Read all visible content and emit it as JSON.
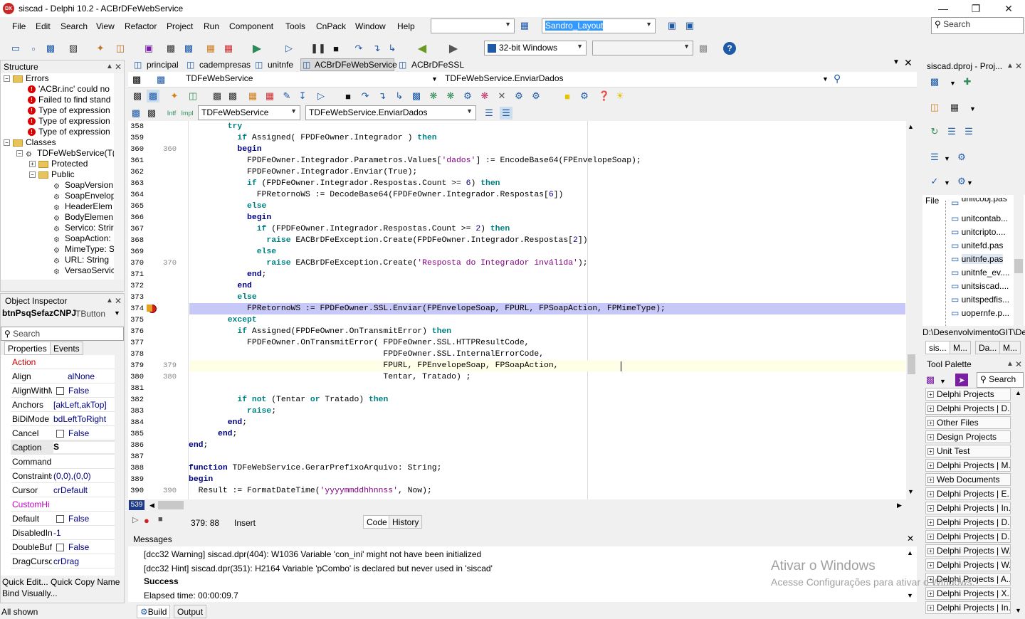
{
  "window": {
    "title": "siscad - Delphi 10.2 - ACBrDFeWebService",
    "app_icon": "DX"
  },
  "menu": [
    "File",
    "Edit",
    "Search",
    "View",
    "Refactor",
    "Project",
    "Run",
    "Component",
    "Tools",
    "CnPack",
    "Window",
    "Help"
  ],
  "toolbar": {
    "layout_combo": "Sandro_Layout",
    "platform_combo": "32-bit Windows",
    "search_placeholder": "Search"
  },
  "structure": {
    "title": "Structure",
    "items": [
      {
        "label": "Errors"
      },
      {
        "label": "'ACBr.inc' could no"
      },
      {
        "label": "Failed to find stand"
      },
      {
        "label": "Type of expression"
      },
      {
        "label": "Type of expression"
      },
      {
        "label": "Type of expression"
      },
      {
        "label": "Classes"
      },
      {
        "label": "TDFeWebService(T("
      },
      {
        "label": "Protected"
      },
      {
        "label": "Public"
      },
      {
        "label": "SoapVersion"
      },
      {
        "label": "SoapEnvelop"
      },
      {
        "label": "HeaderElem"
      },
      {
        "label": "BodyElemen"
      },
      {
        "label": "Servico: Strir"
      },
      {
        "label": "SoapAction:"
      },
      {
        "label": "MimeType: S"
      },
      {
        "label": "URL: String"
      },
      {
        "label": "VersaoServic"
      }
    ]
  },
  "object_inspector": {
    "title": "Object Inspector",
    "component": "btnPsqSefazCNPJ",
    "component_type": "TButton",
    "search_placeholder": "Search",
    "tabs": [
      "Properties",
      "Events"
    ],
    "rows": [
      {
        "name": "Action",
        "value": ""
      },
      {
        "name": "Align",
        "value": "alNone"
      },
      {
        "name": "AlignWithM",
        "value": "False"
      },
      {
        "name": "Anchors",
        "value": "[akLeft,akTop]"
      },
      {
        "name": "BiDiMode",
        "value": "bdLeftToRight"
      },
      {
        "name": "Cancel",
        "value": "False"
      },
      {
        "name": "Caption",
        "value": "S"
      },
      {
        "name": "Command",
        "value": ""
      },
      {
        "name": "Constraints",
        "value": "(0,0),(0,0)"
      },
      {
        "name": "Cursor",
        "value": "crDefault"
      },
      {
        "name": "CustomHi",
        "value": ""
      },
      {
        "name": "Default",
        "value": "False"
      },
      {
        "name": "DisabledIn",
        "value": "-1"
      },
      {
        "name": "DoubleBuf",
        "value": "False"
      },
      {
        "name": "DragCurso",
        "value": "crDrag"
      }
    ],
    "links": [
      "Quick Edit...",
      "Quick Copy Name",
      "Bind Visually..."
    ],
    "status": "All shown"
  },
  "editor_tabs": [
    "principal",
    "cadempresas",
    "unitnfe",
    "ACBrDFeWebService",
    "ACBrDFeSSL"
  ],
  "editor_header": {
    "class_combo": "TDFeWebService",
    "method_combo": "TDFeWebService.EnviarDados"
  },
  "editor_nav": {
    "class_combo": "TDFeWebService",
    "method_combo": "TDFeWebService.EnviarDados"
  },
  "code_lines": [
    {
      "n": "358",
      "m": "",
      "t": "        try"
    },
    {
      "n": "359",
      "m": "",
      "t": "          if Assigned( FPDFeOwner.Integrador ) then"
    },
    {
      "n": "360",
      "m": "360",
      "t": "          begin"
    },
    {
      "n": "361",
      "m": "",
      "t": "            FPDFeOwner.Integrador.Parametros.Values['dados'] := EncodeBase64(FPEnvelopeSoap);"
    },
    {
      "n": "362",
      "m": "",
      "t": "            FPDFeOwner.Integrador.Enviar(True);"
    },
    {
      "n": "363",
      "m": "",
      "t": "            if (FPDFeOwner.Integrador.Respostas.Count >= 6) then"
    },
    {
      "n": "364",
      "m": "",
      "t": "              FPRetornoWS := DecodeBase64(FPDFeOwner.Integrador.Respostas[6])"
    },
    {
      "n": "365",
      "m": "",
      "t": "            else"
    },
    {
      "n": "366",
      "m": "",
      "t": "            begin"
    },
    {
      "n": "367",
      "m": "",
      "t": "              if (FPDFeOwner.Integrador.Respostas.Count >= 2) then"
    },
    {
      "n": "368",
      "m": "",
      "t": "                raise EACBrDFeException.Create(FPDFeOwner.Integrador.Respostas[2])"
    },
    {
      "n": "369",
      "m": "",
      "t": "              else"
    },
    {
      "n": "370",
      "m": "370",
      "t": "                raise EACBrDFeException.Create('Resposta do Integrador inválida');"
    },
    {
      "n": "371",
      "m": "",
      "t": "            end;"
    },
    {
      "n": "372",
      "m": "",
      "t": "          end"
    },
    {
      "n": "373",
      "m": "",
      "t": "          else"
    },
    {
      "n": "374",
      "m": "",
      "t": "            FPRetornoWS := FPDFeOwner.SSL.Enviar(FPEnvelopeSoap, FPURL, FPSoapAction, FPMimeType);"
    },
    {
      "n": "375",
      "m": "",
      "t": "        except"
    },
    {
      "n": "376",
      "m": "",
      "t": "          if Assigned(FPDFeOwner.OnTransmitError) then"
    },
    {
      "n": "377",
      "m": "",
      "t": "            FPDFeOwner.OnTransmitError( FPDFeOwner.SSL.HTTPResultCode,"
    },
    {
      "n": "378",
      "m": "",
      "t": "                                        FPDFeOwner.SSL.InternalErrorCode,"
    },
    {
      "n": "379",
      "m": "379",
      "t": "                                        FPURL, FPEnvelopeSoap, FPSoapAction,"
    },
    {
      "n": "380",
      "m": "380",
      "t": "                                        Tentar, Tratado) ;"
    },
    {
      "n": "381",
      "m": "",
      "t": ""
    },
    {
      "n": "382",
      "m": "",
      "t": "          if not (Tentar or Tratado) then"
    },
    {
      "n": "383",
      "m": "",
      "t": "            raise;"
    },
    {
      "n": "384",
      "m": "",
      "t": "        end;"
    },
    {
      "n": "385",
      "m": "",
      "t": "      end;"
    },
    {
      "n": "386",
      "m": "",
      "t": "end;"
    },
    {
      "n": "387",
      "m": "",
      "t": ""
    },
    {
      "n": "388",
      "m": "",
      "t": "function TDFeWebService.GerarPrefixoArquivo: String;"
    },
    {
      "n": "389",
      "m": "",
      "t": "begin"
    },
    {
      "n": "390",
      "m": "390",
      "t": "  Result := FormatDateTime('yyyymmddhhnnss', Now);"
    }
  ],
  "editor_status": {
    "badge": "539",
    "position": "379:  88",
    "mode": "Insert",
    "tabs": [
      "Code",
      "History"
    ]
  },
  "messages": {
    "title": "Messages",
    "lines": [
      "[dcc32 Warning] siscad.dpr(404): W1036 Variable 'con_ini' might not have been initialized",
      "[dcc32 Hint] siscad.dpr(351): H2164 Variable 'pCombo' is declared but never used in 'siscad'",
      "Success",
      "Elapsed time: 00:00:09.7"
    ],
    "tabs": [
      "Build",
      "Output"
    ]
  },
  "project": {
    "title": "siscad.dproj - Proj...",
    "file_header": "File",
    "files": [
      "unitcobj.pas",
      "unitcontab...",
      "unitcripto....",
      "unitefd.pas",
      "unitnfe.pas",
      "unitnfe_ev....",
      "unitsiscad....",
      "unitspedfis...",
      "uopernfe.p..."
    ],
    "path": "D:\\DesenvolvimentoGIT\\De",
    "tabs": [
      "sis...",
      "M...",
      "Da...",
      "M..."
    ]
  },
  "tool_palette": {
    "title": "Tool Palette",
    "search_placeholder": "Search",
    "items": [
      "Delphi Projects",
      "Delphi Projects | D...",
      "Other Files",
      "Design Projects",
      "Unit Test",
      "Delphi Projects | M...",
      "Web Documents",
      "Delphi Projects | E...",
      "Delphi Projects | In...",
      "Delphi Projects | D...",
      "Delphi Projects | D...",
      "Delphi Projects | W...",
      "Delphi Projects | W...",
      "Delphi Projects | A...",
      "Delphi Projects | X...",
      "Delphi Projects | In..."
    ]
  },
  "watermark": {
    "line1": "Ativar o Windows",
    "line2": "Acesse Configurações para ativar o Windows."
  }
}
